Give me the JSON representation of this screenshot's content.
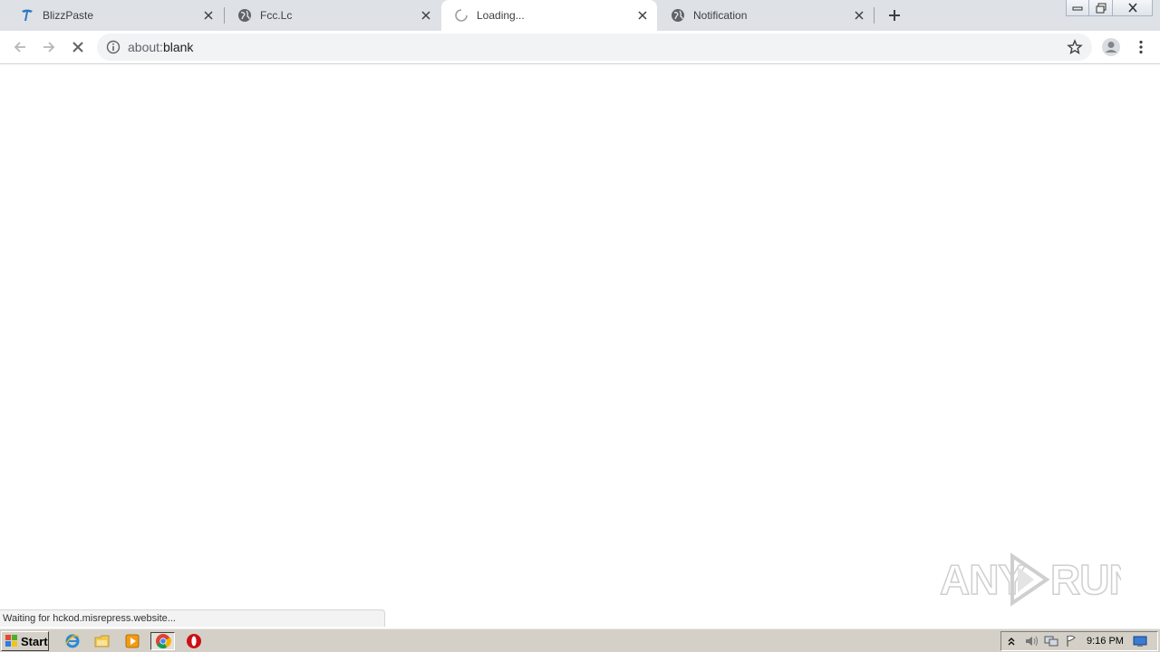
{
  "browser": {
    "tabs": [
      {
        "title": "BlizzPaste",
        "icon": "blizzpaste-icon",
        "active": false
      },
      {
        "title": "Fcc.Lc",
        "icon": "globe-icon",
        "active": false
      },
      {
        "title": "Loading...",
        "icon": "loading-spinner-icon",
        "active": true
      },
      {
        "title": "Notification",
        "icon": "globe-icon",
        "active": false
      }
    ],
    "new_tab_icon": "plus-icon",
    "window_controls": [
      "minimize-icon",
      "restore-icon",
      "close-icon"
    ]
  },
  "toolbar": {
    "back_icon": "back-arrow-icon",
    "forward_icon": "forward-arrow-icon",
    "stop_icon": "stop-icon",
    "url_scheme": "about:",
    "url_rest": "blank",
    "info_icon": "info-icon",
    "bookmark_icon": "star-icon",
    "profile_icon": "avatar-icon",
    "menu_icon": "kebab-menu-icon"
  },
  "status": {
    "text": "Waiting for hckod.misrepress.website..."
  },
  "watermark": {
    "text": "ANY RUN"
  },
  "taskbar": {
    "start_label": "Start",
    "quick_launch": [
      "ie-icon",
      "folder-icon",
      "media-player-icon",
      "chrome-icon",
      "opera-icon"
    ],
    "tray_icons": [
      "show-hidden-icon",
      "volume-icon",
      "network-icon",
      "action-center-flag-icon"
    ],
    "clock": "9:16 PM",
    "show_desktop_icon": "show-desktop-icon"
  },
  "colors": {
    "tabstrip_bg": "#dee1e6",
    "omnibox_bg": "#f1f3f4",
    "taskbar_bg": "#d4d0c8"
  }
}
